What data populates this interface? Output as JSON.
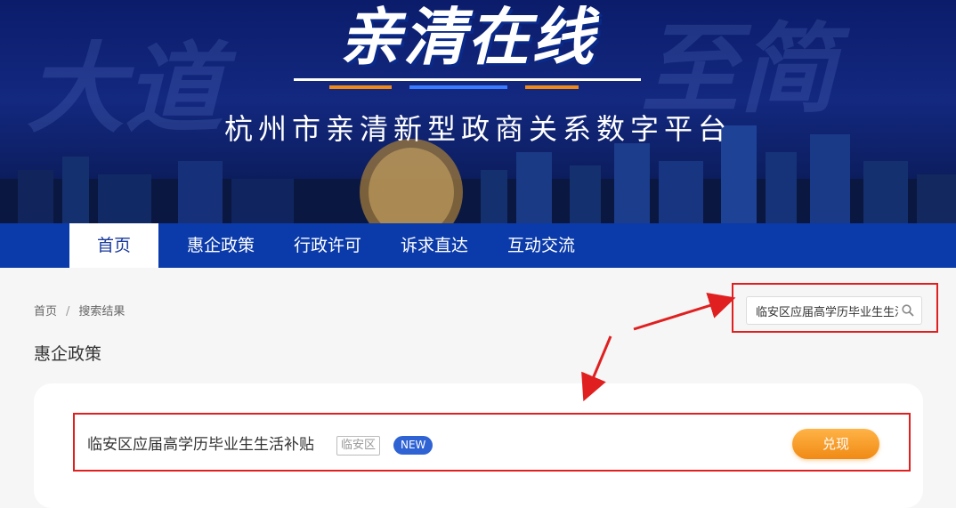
{
  "banner": {
    "logo_title": "亲清在线",
    "subtitle": "杭州市亲清新型政商关系数字平台",
    "bg_word_left": "大道",
    "bg_word_right": "至简"
  },
  "nav": {
    "items": [
      {
        "label": "首页",
        "active": true
      },
      {
        "label": "惠企政策",
        "active": false
      },
      {
        "label": "行政许可",
        "active": false
      },
      {
        "label": "诉求直达",
        "active": false
      },
      {
        "label": "互动交流",
        "active": false
      }
    ]
  },
  "breadcrumb": {
    "home": "首页",
    "separator": "/",
    "current": "搜索结果"
  },
  "section": {
    "title": "惠企政策"
  },
  "search": {
    "value": "临安区应届高学历毕业生生活补贴",
    "icon": "search-icon"
  },
  "results": [
    {
      "title": "临安区应届高学历毕业生生活补贴",
      "region": "临安区",
      "badge": "NEW",
      "action": "兑现"
    }
  ],
  "colors": {
    "nav_bg": "#0b3baa",
    "annotation_red": "#e02020",
    "button_orange": "#f08a14",
    "badge_blue": "#2f63d4"
  }
}
